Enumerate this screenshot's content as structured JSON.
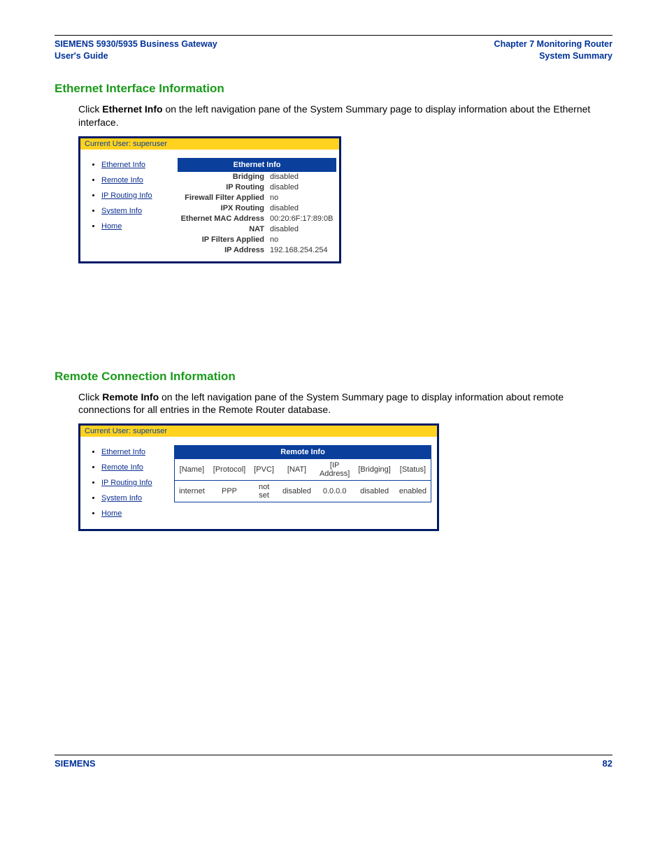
{
  "header": {
    "left_line1": "SIEMENS 5930/5935 Business Gateway",
    "left_line2": "User's Guide",
    "right_line1": "Chapter 7  Monitoring Router",
    "right_line2": "System Summary"
  },
  "section1": {
    "heading": "Ethernet Interface Information",
    "para_pre": "Click ",
    "para_bold": "Ethernet Info",
    "para_post": " on the left navigation pane of the System Summary page to display information about the Ethernet interface.",
    "topbar": "Current User: superuser",
    "nav": [
      "Ethernet Info",
      "Remote Info",
      "IP Routing Info",
      "System Info",
      "Home"
    ],
    "panel_title": "Ethernet Info",
    "rows": [
      {
        "k": "Bridging",
        "v": "disabled"
      },
      {
        "k": "IP Routing",
        "v": "disabled"
      },
      {
        "k": "Firewall Filter Applied",
        "v": "no"
      },
      {
        "k": "IPX Routing",
        "v": "disabled"
      },
      {
        "k": "Ethernet MAC Address",
        "v": "00:20:6F:17:89:0B"
      },
      {
        "k": "NAT",
        "v": "disabled"
      },
      {
        "k": "IP Filters Applied",
        "v": "no"
      },
      {
        "k": "IP Address",
        "v": "192.168.254.254"
      }
    ]
  },
  "section2": {
    "heading": "Remote Connection Information",
    "para_pre": "Click ",
    "para_bold": "Remote Info",
    "para_post": " on the left navigation pane of the System Summary page to display information about remote connections for all entries in the Remote Router database.",
    "topbar": "Current User: superuser",
    "nav": [
      "Ethernet Info",
      "Remote Info",
      "IP Routing Info",
      "System Info",
      "Home"
    ],
    "panel_title": "Remote Info",
    "columns": [
      "[Name]",
      "[Protocol]",
      "[PVC]",
      "[NAT]",
      "[IP Address]",
      "[Bridging]",
      "[Status]"
    ],
    "data_rows": [
      [
        "internet",
        "PPP",
        "not set",
        "disabled",
        "0.0.0.0",
        "disabled",
        "enabled"
      ]
    ]
  },
  "footer": {
    "left": "SIEMENS",
    "right": "82"
  }
}
